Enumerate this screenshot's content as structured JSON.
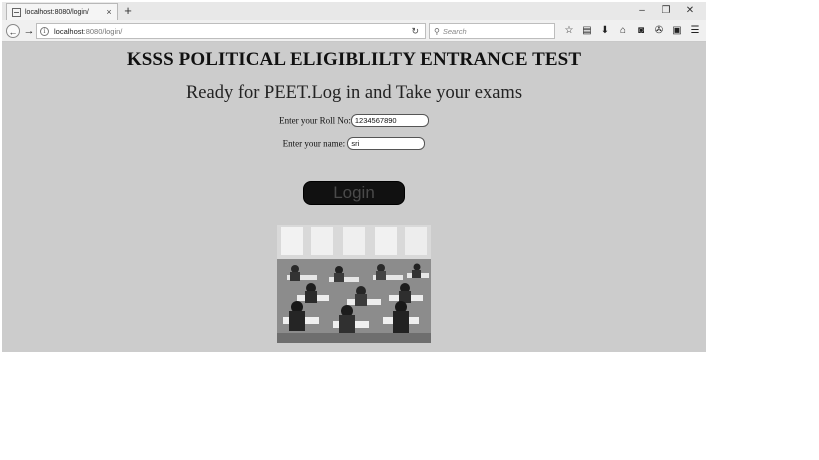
{
  "browser": {
    "tab_title": "localhost:8080/login/",
    "tab_close": "×",
    "new_tab": "+",
    "window_buttons": {
      "minimize": "–",
      "restore": "❐",
      "close": "✕"
    },
    "url_host": "localhost",
    "url_rest": ":8080/login/",
    "search_placeholder": "Search",
    "back_glyph": "←",
    "forward_glyph": "→",
    "reload_glyph": "↻",
    "search_glyph": "🔍",
    "toolbar_icons": [
      {
        "name": "bookmark-star-icon",
        "glyph": "☆"
      },
      {
        "name": "reading-list-icon",
        "glyph": "▤"
      },
      {
        "name": "downloads-icon",
        "glyph": "⬇"
      },
      {
        "name": "home-icon",
        "glyph": "⌂"
      },
      {
        "name": "pocket-icon",
        "glyph": "◙"
      },
      {
        "name": "extension-icon",
        "glyph": "✇"
      },
      {
        "name": "screenshot-icon",
        "glyph": "▣"
      },
      {
        "name": "menu-icon",
        "glyph": "☰"
      }
    ]
  },
  "page": {
    "title": "KSSS POLITICAL ELIGIBLILTY ENTRANCE TEST",
    "subtitle": "Ready for PEET.Log in and Take your exams",
    "roll_label": "Enter your Roll No:",
    "roll_value": "1234567890",
    "name_label": "Enter your name:",
    "name_value": "sri",
    "login_label": "Login"
  }
}
